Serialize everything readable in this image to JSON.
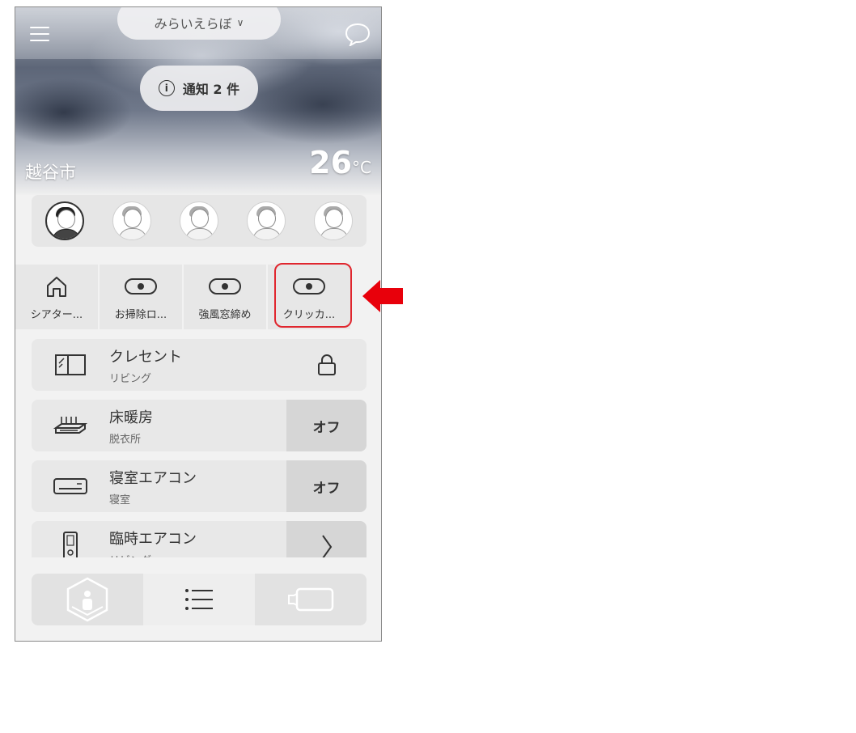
{
  "header": {
    "home_name": "みらいえらぼ",
    "notice_label": "通知 2 件"
  },
  "weather": {
    "city": "越谷市",
    "temp_value": "26",
    "temp_unit": "°C"
  },
  "users": [
    {
      "name": "user-1",
      "active": true
    },
    {
      "name": "user-2",
      "active": false
    },
    {
      "name": "user-3",
      "active": false
    },
    {
      "name": "user-4",
      "active": false
    },
    {
      "name": "user-5",
      "active": false
    }
  ],
  "scenes": [
    {
      "label": "シアター...",
      "icon": "home-icon"
    },
    {
      "label": "お掃除ロ...",
      "icon": "toggle-icon"
    },
    {
      "label": "強風窓締め",
      "icon": "toggle-icon"
    },
    {
      "label": "クリッカ...",
      "icon": "toggle-icon"
    }
  ],
  "devices": [
    {
      "name": "クレセント",
      "room": "リビング",
      "icon": "window-icon",
      "action": "lock-icon"
    },
    {
      "name": "床暖房",
      "room": "脱衣所",
      "icon": "floor-heater-icon",
      "action": "オフ"
    },
    {
      "name": "寝室エアコン",
      "room": "寝室",
      "icon": "air-conditioner-icon",
      "action": "オフ"
    },
    {
      "name": "臨時エアコン",
      "room": "リビング",
      "icon": "remote-icon",
      "action": "chevron-right-icon"
    }
  ],
  "tabs": [
    "home-3d-icon",
    "list-icon",
    "camera-icon"
  ],
  "colors": {
    "highlight": "#e0262e",
    "arrow": "#e8000b"
  }
}
